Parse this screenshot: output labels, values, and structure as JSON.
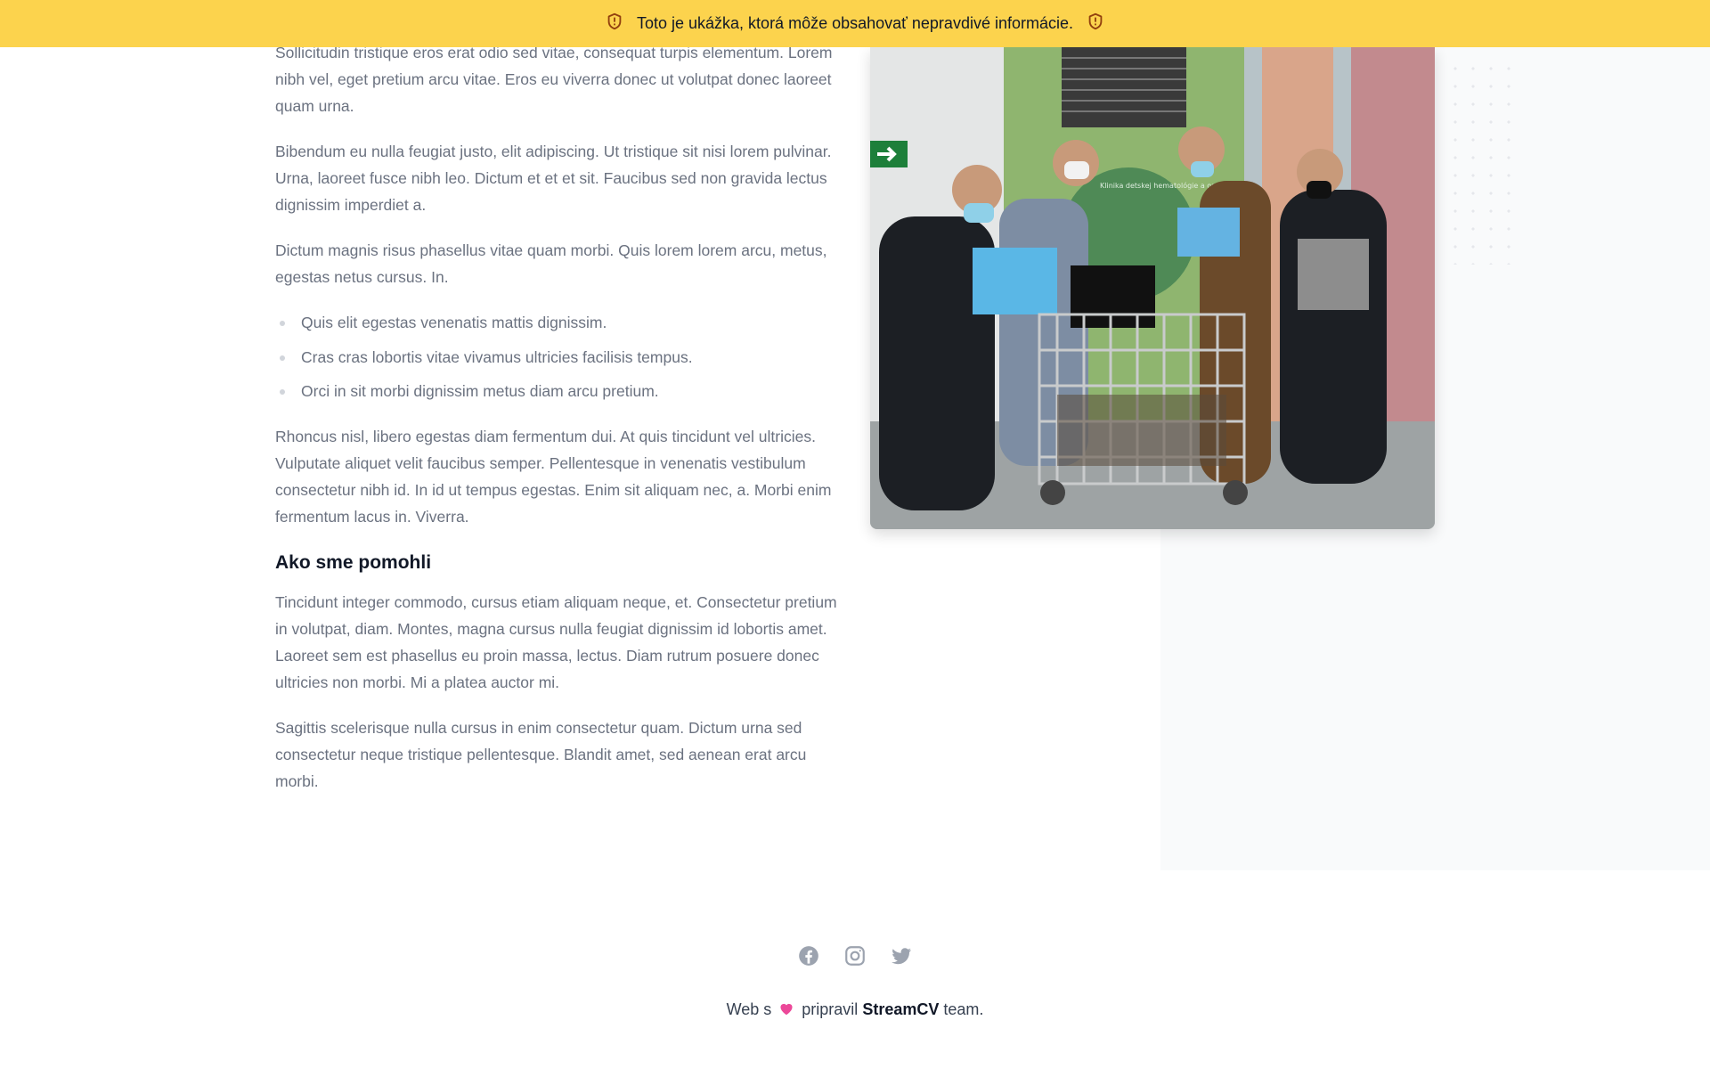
{
  "banner": {
    "text": "Toto je ukážka, ktorá môže obsahovať nepravdivé informácie."
  },
  "article": {
    "paragraphs_top": [
      "Sollicitudin tristique eros erat odio sed vitae, consequat turpis elementum. Lorem nibh vel, eget pretium arcu vitae. Eros eu viverra donec ut volutpat donec laoreet quam urna.",
      "Bibendum eu nulla feugiat justo, elit adipiscing. Ut tristique sit nisi lorem pulvinar. Urna, laoreet fusce nibh leo. Dictum et et et sit. Faucibus sed non gravida lectus dignissim imperdiet a.",
      "Dictum magnis risus phasellus vitae quam morbi. Quis lorem lorem arcu, metus, egestas netus cursus. In."
    ],
    "list_items": [
      "Quis elit egestas venenatis mattis dignissim.",
      "Cras cras lobortis vitae vivamus ultricies facilisis tempus.",
      "Orci in sit morbi dignissim metus diam arcu pretium."
    ],
    "paragraph_after_list": "Rhoncus nisl, libero egestas diam fermentum dui. At quis tincidunt vel ultricies. Vulputate aliquet velit faucibus semper. Pellentesque in venenatis vestibulum consectetur nibh id. In id ut tempus egestas. Enim sit aliquam nec, a. Morbi enim fermentum lacus in. Viverra.",
    "heading": "Ako sme pomohli",
    "paragraphs_bottom": [
      "Tincidunt integer commodo, cursus etiam aliquam neque, et. Consectetur pretium in volutpat, diam. Montes, magna cursus nulla feugiat dignissim id lobortis amet. Laoreet sem est phasellus eu proin massa, lectus. Diam rutrum posuere donec ultricies non morbi. Mi a platea auctor mi.",
      "Sagittis scelerisque nulla cursus in enim consectetur quam. Dictum urna sed consectetur neque tristique pellentesque. Blandit amet, sed aenean erat arcu morbi."
    ]
  },
  "photo": {
    "sign_text": "Klinika detskej hematológie a onkológie LF a FN"
  },
  "footer": {
    "social": [
      "facebook-icon",
      "instagram-icon",
      "twitter-icon"
    ],
    "credit_prefix": "Web s",
    "credit_middle": "pripravil",
    "credit_brand": "StreamCV",
    "credit_suffix": "team."
  },
  "colors": {
    "banner": "#fcd34d",
    "text": "#6b7280",
    "heading": "#111827",
    "icons": "#9ca3af"
  }
}
